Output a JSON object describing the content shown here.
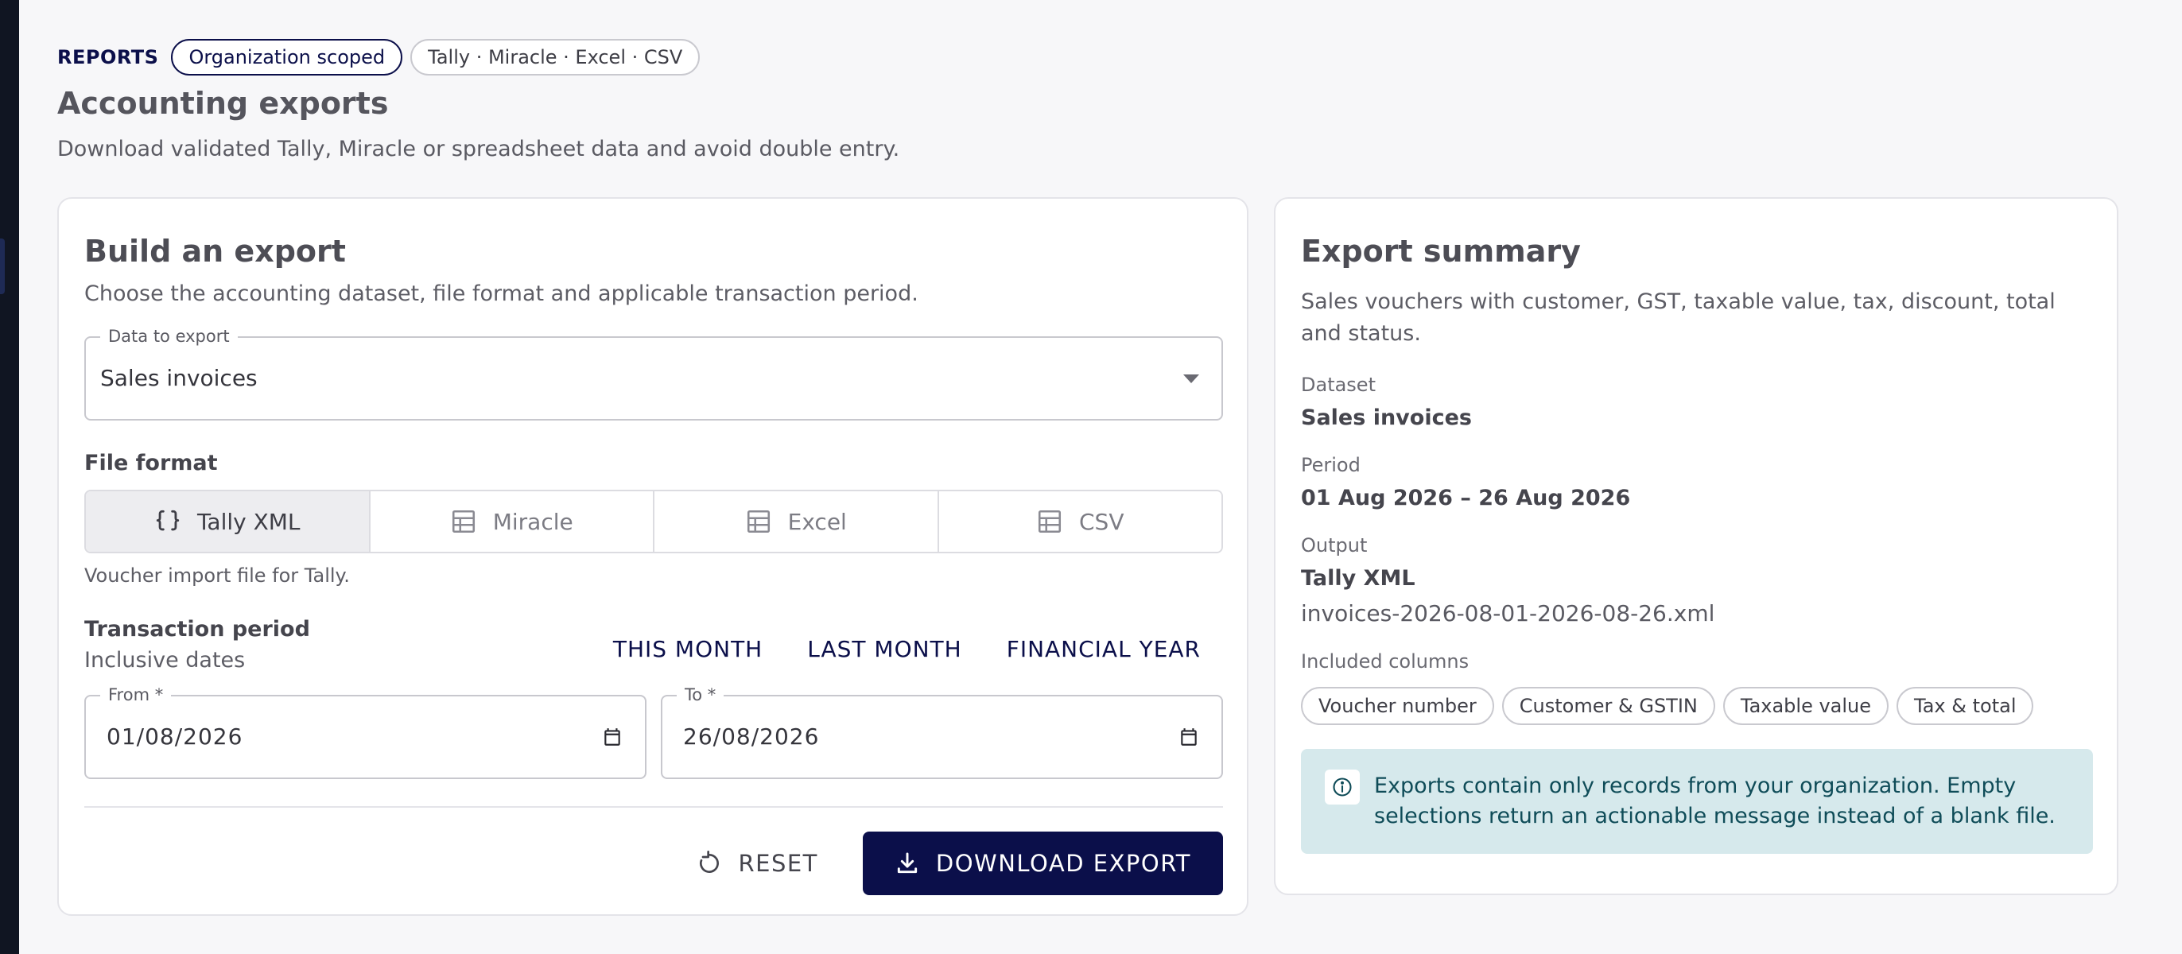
{
  "header": {
    "eyebrow": "REPORTS",
    "scope_chip": "Organization scoped",
    "formats_chip": "Tally · Miracle · Excel · CSV",
    "title": "Accounting exports",
    "subtitle": "Download validated Tally, Miracle or spreadsheet data and avoid double entry."
  },
  "build": {
    "title": "Build an export",
    "description": "Choose the accounting dataset, file format and applicable transaction period.",
    "dataset_field": {
      "label": "Data to export",
      "value": "Sales invoices"
    },
    "format_label": "File format",
    "formats": [
      {
        "label": "Tally XML",
        "icon": "braces-icon",
        "selected": true
      },
      {
        "label": "Miracle",
        "icon": "table-icon",
        "selected": false
      },
      {
        "label": "Excel",
        "icon": "table-icon",
        "selected": false
      },
      {
        "label": "CSV",
        "icon": "table-icon",
        "selected": false
      }
    ],
    "format_help": "Voucher import file for Tally.",
    "period_label": "Transaction period",
    "period_sub": "Inclusive dates",
    "quick_ranges": [
      "THIS MONTH",
      "LAST MONTH",
      "FINANCIAL YEAR"
    ],
    "from": {
      "label": "From *",
      "value": "01/08/2026"
    },
    "to": {
      "label": "To *",
      "value": "26/08/2026"
    },
    "reset_label": "RESET",
    "download_label": "DOWNLOAD EXPORT"
  },
  "summary": {
    "title": "Export summary",
    "description": "Sales vouchers with customer, GST, taxable value, tax, discount, total and status.",
    "dataset_label": "Dataset",
    "dataset_value": "Sales invoices",
    "period_label": "Period",
    "period_value": "01 Aug 2026 – 26 Aug 2026",
    "output_label": "Output",
    "output_value": "Tally XML",
    "output_file": "invoices-2026-08-01-2026-08-26.xml",
    "columns_label": "Included columns",
    "columns": [
      "Voucher number",
      "Customer & GSTIN",
      "Taxable value",
      "Tax & total"
    ],
    "info": "Exports contain only records from your organization. Empty selections return an actionable message instead of a blank file."
  },
  "colors": {
    "primary": "#0b0f4a",
    "info_bg": "#d6e9ec",
    "info_text": "#0f4c58"
  }
}
